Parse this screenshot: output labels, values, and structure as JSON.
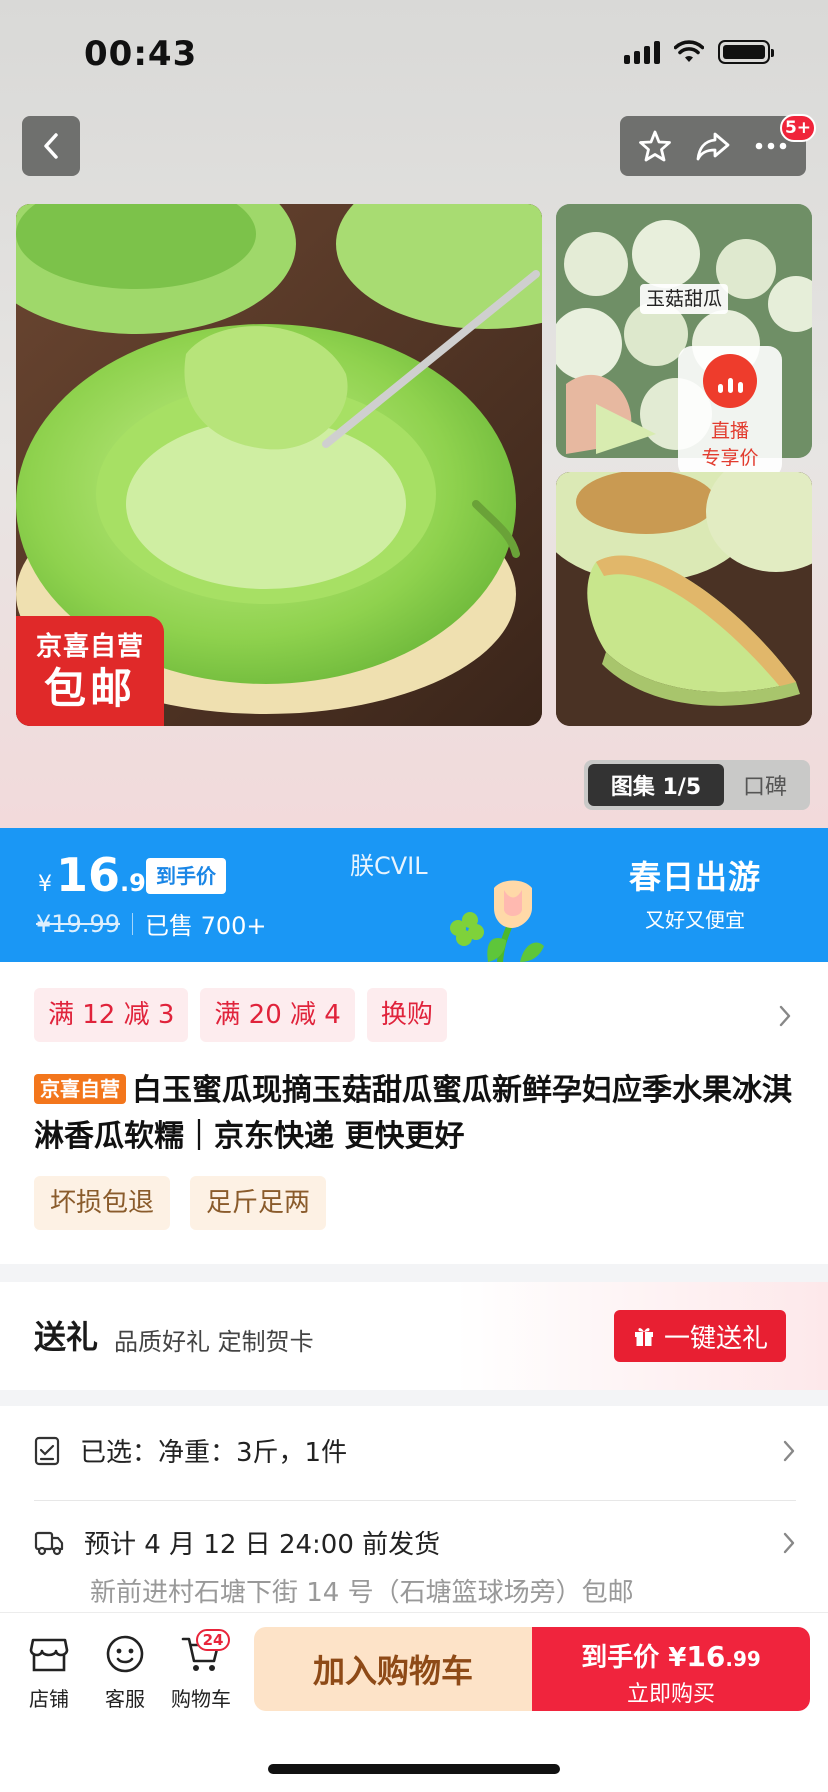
{
  "status_bar": {
    "time": "00:43"
  },
  "header": {
    "more_badge": "5+"
  },
  "gallery": {
    "promo_line1": "京喜自营",
    "promo_line2": "包邮",
    "thumb_label": "玉菇甜瓜",
    "live_line1": "直播",
    "live_line2": "专享价",
    "tab_active": "图集 1/5",
    "tab_other": "口碑"
  },
  "price": {
    "currency": "¥",
    "integer": "16",
    "decimal": ".99",
    "tag": "到手价",
    "original": "¥19.99",
    "sold": "已售 700+",
    "watermark": "朕CVIL",
    "campaign_title": "春日出游",
    "campaign_sub": "又好又便宜"
  },
  "coupons": [
    "满 12 减 3",
    "满 20 减 4",
    "换购"
  ],
  "product": {
    "badge": "京喜自营",
    "title": "白玉蜜瓜现摘玉菇甜瓜蜜瓜新鲜孕妇应季水果冰淇淋香瓜软糯｜京东快递 更快更好",
    "services": [
      "坏损包退",
      "足斤足两"
    ]
  },
  "gift": {
    "title": "送礼",
    "subtitle": "品质好礼 定制贺卡",
    "button": "一键送礼"
  },
  "spec": {
    "selected": "已选：净重：3斤，1件"
  },
  "delivery": {
    "eta": "预计 4 月 12 日 24:00 前发货",
    "address": "新前进村石塘下街 14 号（石塘篮球场旁）包邮"
  },
  "bottom_bar": {
    "store": "店铺",
    "service": "客服",
    "cart": "购物车",
    "cart_count": "24",
    "add_to_cart": "加入购物车",
    "buy_prefix": "到手价",
    "buy_currency": "¥",
    "buy_integer": "16",
    "buy_decimal": ".99",
    "buy_now": "立即购买"
  },
  "colors": {
    "accent_red": "#f0243d",
    "price_banner_blue": "#1a97f5",
    "add_cart_bg": "#fde3c8"
  }
}
